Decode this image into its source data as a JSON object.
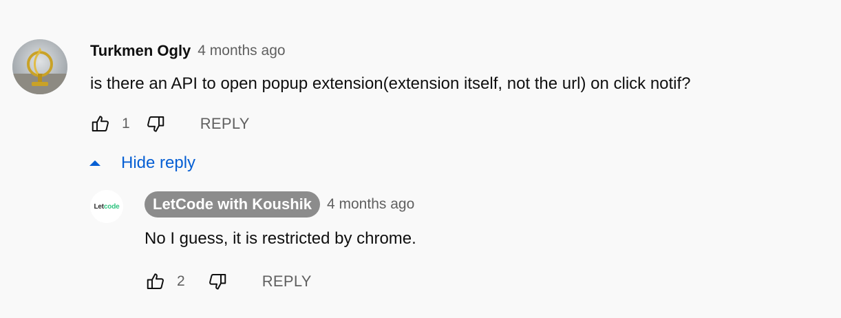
{
  "comment": {
    "author": "Turkmen Ogly",
    "time": "4 months ago",
    "text": "is there an API to open popup extension(extension itself, not the url) on click notif?",
    "like_count": "1",
    "reply_label": "REPLY",
    "avatar_icon": "globe-statue-avatar"
  },
  "toggle": {
    "label": "Hide reply",
    "icon": "caret-up-icon",
    "color": "#065fd4"
  },
  "reply": {
    "author": "LetCode with Koushik",
    "time": "4 months ago",
    "text": "No I guess, it is restricted by chrome.",
    "like_count": "2",
    "reply_label": "REPLY",
    "avatar_logo_text_1": "Let",
    "avatar_logo_text_2": "code",
    "owner_badge_color": "#8c8c8c"
  },
  "icons": {
    "like": "thumbs-up-icon",
    "dislike": "thumbs-down-icon"
  }
}
